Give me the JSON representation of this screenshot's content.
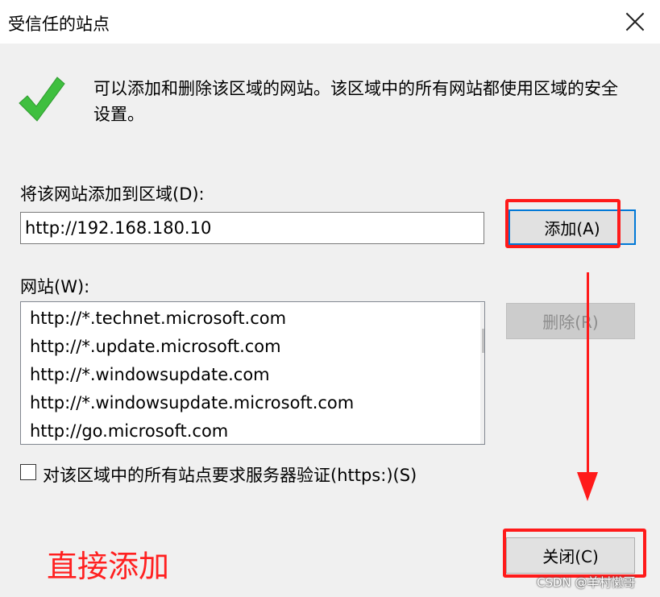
{
  "window": {
    "title": "受信任的站点"
  },
  "info": {
    "text": "可以添加和删除该区域的网站。该区域中的所有网站都使用区域的安全设置。"
  },
  "add_section": {
    "label": "将该网站添加到区域(D):",
    "input_value": "http://192.168.180.10",
    "add_button": "添加(A)"
  },
  "sites_section": {
    "label": "网站(W):",
    "items": [
      "http://*.technet.microsoft.com",
      "http://*.update.microsoft.com",
      "http://*.windowsupdate.com",
      "http://*.windowsupdate.microsoft.com",
      "http://go.microsoft.com"
    ],
    "remove_button": "删除(R)"
  },
  "https_checkbox": {
    "label": "对该区域中的所有站点要求服务器验证(https:)(S)",
    "checked": false
  },
  "close_button": "关闭(C)",
  "annotation": {
    "text": "直接添加",
    "color": "#ff1a1a"
  },
  "watermark": "CSDN @羊村懒哥",
  "colors": {
    "accent": "#0078d7",
    "check": "#3fbf3f"
  }
}
